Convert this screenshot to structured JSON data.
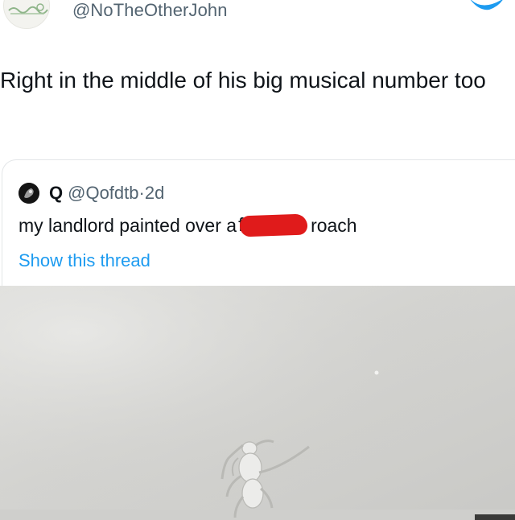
{
  "tweet": {
    "handle": "@NoTheOtherJohn",
    "text": "Right in the middle of his big musical number too"
  },
  "quoted_tweet": {
    "name": "Q",
    "handle": "@Qofdtb",
    "separator": "·",
    "age": "2d",
    "text_before": "my landlord painted over a",
    "censored_first_letter": "f",
    "text_after": "roach",
    "show_thread_label": "Show this thread"
  },
  "colors": {
    "link": "#1d9bf0",
    "censor": "#e01b1b",
    "wall": "#d9d9d6"
  },
  "icons": [
    "bird-icon",
    "avatar",
    "censor-bar"
  ]
}
